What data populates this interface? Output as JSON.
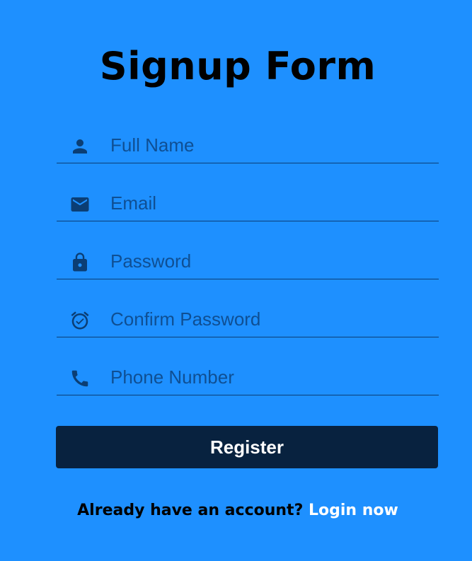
{
  "form": {
    "title": "Signup Form",
    "fields": [
      {
        "icon": "person-icon",
        "placeholder": "Full Name",
        "value": ""
      },
      {
        "icon": "mail-icon",
        "placeholder": "Email",
        "value": ""
      },
      {
        "icon": "lock-icon",
        "placeholder": "Password",
        "value": ""
      },
      {
        "icon": "alarm-check-icon",
        "placeholder": "Confirm Password",
        "value": ""
      },
      {
        "icon": "phone-icon",
        "placeholder": "Phone Number",
        "value": ""
      }
    ],
    "register_label": "Register",
    "login_prompt": "Already have an account?",
    "login_link": "Login now"
  },
  "colors": {
    "background": "#1e90ff",
    "button": "#08223f",
    "icon": "#0b3e74",
    "link": "#ffffff"
  }
}
